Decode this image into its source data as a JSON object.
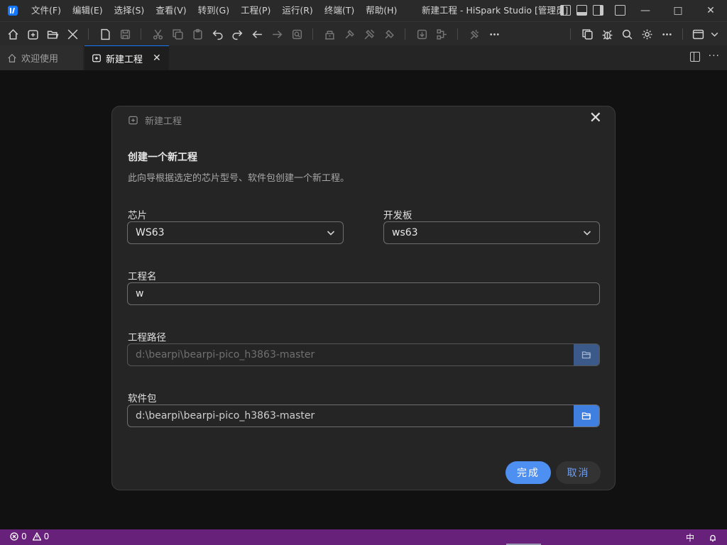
{
  "titlebar": {
    "menu": [
      "文件(F)",
      "编辑(E)",
      "选择(S)",
      "查看(V)",
      "转到(G)",
      "工程(P)",
      "运行(R)",
      "终端(T)",
      "帮助(H)"
    ],
    "window_title": "新建工程 - HiSpark Studio [管理员]"
  },
  "toolbar": {
    "icons": [
      "home-icon",
      "new-project-icon",
      "open-folder-icon",
      "tools-icon",
      "new-file-icon",
      "save-icon",
      "cut-icon",
      "copy-icon",
      "paste-icon",
      "undo-icon",
      "redo-icon",
      "back-icon",
      "forward-icon",
      "find-icon",
      "build-icon",
      "rebuild-icon",
      "clean-icon",
      "flash-icon",
      "import-icon",
      "config-icon",
      "debug-icon",
      "more-icon",
      "files-icon",
      "bug-icon",
      "search-icon",
      "settings-icon",
      "more-icon",
      "layout-icon"
    ]
  },
  "tabs": [
    {
      "label": "欢迎使用",
      "active": false
    },
    {
      "label": "新建工程",
      "active": true
    }
  ],
  "dialog": {
    "header": "新建工程",
    "title": "创建一个新工程",
    "description": "此向导根据选定的芯片型号、软件包创建一个新工程。",
    "chip": {
      "label": "芯片",
      "value": "WS63"
    },
    "board": {
      "label": "开发板",
      "value": "ws63"
    },
    "project_name": {
      "label": "工程名",
      "value": "w"
    },
    "project_path": {
      "label": "工程路径",
      "value": "d:\\bearpi\\bearpi-pico_h3863-master"
    },
    "package": {
      "label": "软件包",
      "value": "d:\\bearpi\\bearpi-pico_h3863-master"
    },
    "finish_label": "完成",
    "cancel_label": "取消"
  },
  "statusbar": {
    "errors": "0",
    "warnings": "0",
    "language": "中",
    "color": "#68217a"
  },
  "colors": {
    "accent": "#4e8ff2",
    "status": "#68217a"
  }
}
